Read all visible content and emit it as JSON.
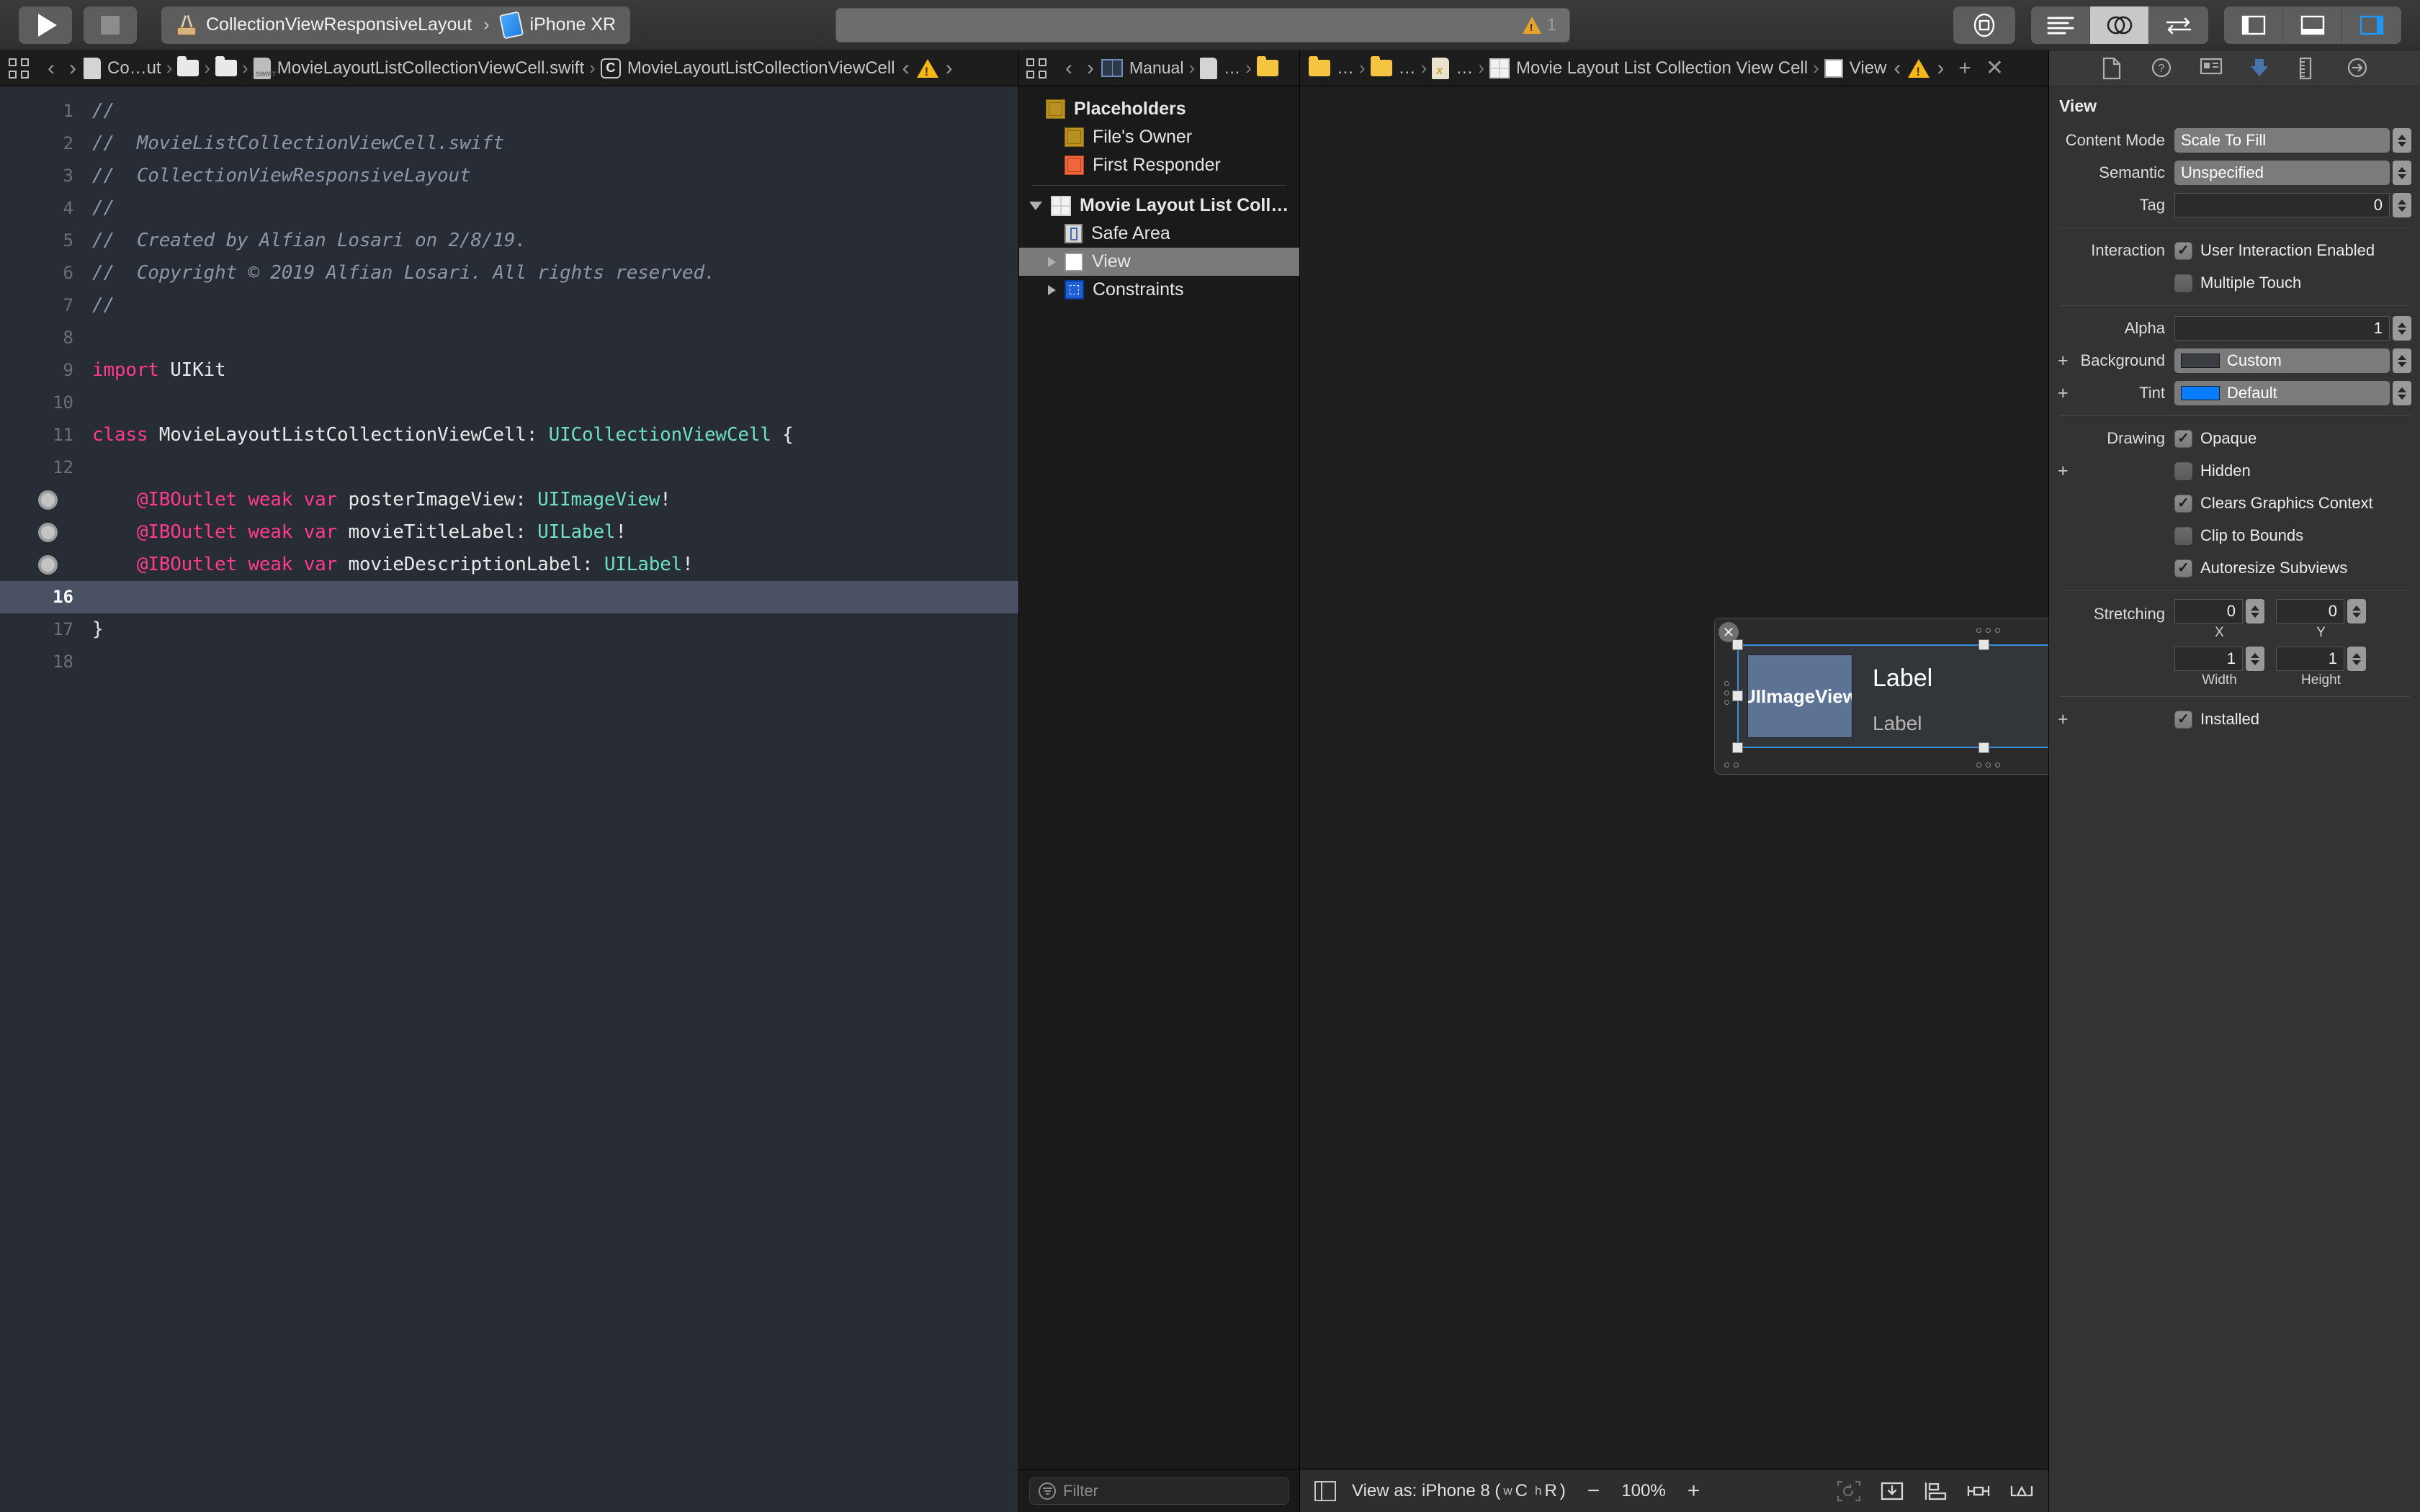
{
  "toolbar": {
    "run_label": "run-button",
    "stop_label": "stop-button",
    "scheme": "CollectionViewResponsiveLayout",
    "destination": "iPhone XR",
    "chevron": "›",
    "warning_count": "1",
    "icons": {
      "library": "library-icon",
      "standard_editor": "standard-editor-icon",
      "assistant_editor": "assistant-editor-icon",
      "version_editor": "version-editor-icon",
      "nav_panel": "navigator-toggle-icon",
      "debug_panel": "debug-area-toggle-icon",
      "utility_panel": "utilities-toggle-icon"
    }
  },
  "editor": {
    "jumpbar": [
      {
        "icon": "project-icon",
        "label": "Co…ut"
      },
      {
        "icon": "folder-icon",
        "label": ""
      },
      {
        "icon": "folder-icon",
        "label": ""
      },
      {
        "icon": "swift-file-icon",
        "label": "MovieLayoutListCollectionViewCell.swift"
      },
      {
        "icon": "class-icon",
        "label": "MovieLayoutListCollectionViewCell"
      }
    ],
    "lines": [
      {
        "n": "1",
        "bp": false,
        "cur": false,
        "tokens": [
          {
            "t": "cmt",
            "s": "//"
          }
        ]
      },
      {
        "n": "2",
        "bp": false,
        "cur": false,
        "tokens": [
          {
            "t": "cmt",
            "s": "//  MovieListCollectionViewCell.swift"
          }
        ]
      },
      {
        "n": "3",
        "bp": false,
        "cur": false,
        "tokens": [
          {
            "t": "cmt",
            "s": "//  CollectionViewResponsiveLayout"
          }
        ]
      },
      {
        "n": "4",
        "bp": false,
        "cur": false,
        "tokens": [
          {
            "t": "cmt",
            "s": "//"
          }
        ]
      },
      {
        "n": "5",
        "bp": false,
        "cur": false,
        "tokens": [
          {
            "t": "cmt",
            "s": "//  Created by Alfian Losari on 2/8/19."
          }
        ]
      },
      {
        "n": "6",
        "bp": false,
        "cur": false,
        "tokens": [
          {
            "t": "cmt",
            "s": "//  Copyright © 2019 Alfian Losari. All rights reserved."
          }
        ]
      },
      {
        "n": "7",
        "bp": false,
        "cur": false,
        "tokens": [
          {
            "t": "cmt",
            "s": "//"
          }
        ]
      },
      {
        "n": "8",
        "bp": false,
        "cur": false,
        "tokens": []
      },
      {
        "n": "9",
        "bp": false,
        "cur": false,
        "tokens": [
          {
            "t": "kw",
            "s": "import"
          },
          {
            "t": "plain",
            "s": " UIKit"
          }
        ]
      },
      {
        "n": "10",
        "bp": false,
        "cur": false,
        "tokens": []
      },
      {
        "n": "11",
        "bp": false,
        "cur": false,
        "tokens": [
          {
            "t": "kw",
            "s": "class"
          },
          {
            "t": "plain",
            "s": " MovieLayoutListCollectionViewCell: "
          },
          {
            "t": "type",
            "s": "UICollectionViewCell"
          },
          {
            "t": "plain",
            "s": " {"
          }
        ]
      },
      {
        "n": "12",
        "bp": false,
        "cur": false,
        "tokens": []
      },
      {
        "n": "13",
        "bp": true,
        "cur": false,
        "tokens": [
          {
            "t": "plain",
            "s": "    "
          },
          {
            "t": "kw",
            "s": "@IBOutlet weak var"
          },
          {
            "t": "plain",
            "s": " posterImageView: "
          },
          {
            "t": "type",
            "s": "UIImageView"
          },
          {
            "t": "plain",
            "s": "!"
          }
        ]
      },
      {
        "n": "14",
        "bp": true,
        "cur": false,
        "tokens": [
          {
            "t": "plain",
            "s": "    "
          },
          {
            "t": "kw",
            "s": "@IBOutlet weak var"
          },
          {
            "t": "plain",
            "s": " movieTitleLabel: "
          },
          {
            "t": "type",
            "s": "UILabel"
          },
          {
            "t": "plain",
            "s": "!"
          }
        ]
      },
      {
        "n": "15",
        "bp": true,
        "cur": false,
        "tokens": [
          {
            "t": "plain",
            "s": "    "
          },
          {
            "t": "kw",
            "s": "@IBOutlet weak var"
          },
          {
            "t": "plain",
            "s": " movieDescriptionLabel: "
          },
          {
            "t": "type",
            "s": "UILabel"
          },
          {
            "t": "plain",
            "s": "!"
          }
        ]
      },
      {
        "n": "16",
        "bp": false,
        "cur": true,
        "tokens": []
      },
      {
        "n": "17",
        "bp": false,
        "cur": false,
        "tokens": [
          {
            "t": "plain",
            "s": "}"
          }
        ]
      },
      {
        "n": "18",
        "bp": false,
        "cur": false,
        "tokens": []
      }
    ]
  },
  "outline": {
    "jumpbar": [
      {
        "icon": "manual-icon",
        "label": "Manual"
      },
      {
        "icon": "project-icon",
        "label": "…"
      },
      {
        "icon": "folder-icon",
        "label": "…"
      }
    ],
    "items": [
      {
        "label": "Placeholders",
        "icon": "cube-icon",
        "indent": 0,
        "bold": true,
        "selected": false,
        "triangle": "none"
      },
      {
        "label": "File's Owner",
        "icon": "cube-icon",
        "indent": 1,
        "bold": false,
        "selected": false,
        "triangle": "none"
      },
      {
        "label": "First Responder",
        "icon": "responder-icon",
        "indent": 1,
        "bold": false,
        "selected": false,
        "triangle": "none"
      },
      {
        "label": "Movie Layout List Coll…",
        "icon": "cell-icon",
        "indent": 0,
        "bold": true,
        "selected": false,
        "triangle": "open"
      },
      {
        "label": "Safe Area",
        "icon": "safe-area-icon",
        "indent": 1,
        "bold": false,
        "selected": false,
        "triangle": "none"
      },
      {
        "label": "View",
        "icon": "view-icon",
        "indent": 1,
        "bold": false,
        "selected": true,
        "triangle": "closed"
      },
      {
        "label": "Constraints",
        "icon": "constraints-icon",
        "indent": 1,
        "bold": false,
        "selected": false,
        "triangle": "closed"
      }
    ],
    "filter_placeholder": "Filter"
  },
  "canvas": {
    "jumpbar": [
      {
        "icon": "folder-yellow-icon",
        "label": "…"
      },
      {
        "icon": "folder-yellow-icon",
        "label": "…"
      },
      {
        "icon": "xib-file-icon",
        "label": "…"
      },
      {
        "icon": "cell-icon",
        "label": "Movie Layout List Collection View Cell"
      },
      {
        "icon": "view-icon",
        "label": "View"
      }
    ],
    "cell": {
      "poster_label": "UIImageView",
      "title_label": "Label",
      "description_label": "Label"
    },
    "footer": {
      "view_as_prefix": "View as: iPhone 8 (",
      "width_class_prefix": "w",
      "width_class": "C",
      "height_class_prefix": "h",
      "height_class": "R",
      "view_as_suffix": ")",
      "minus": "−",
      "zoom": "100%",
      "plus": "+",
      "icons": [
        "update-frames-icon",
        "embed-in-icon",
        "align-icon",
        "add-new-constraints-icon",
        "resolve-auto-layout-issues-icon"
      ]
    }
  },
  "inspector": {
    "tabs": [
      "file-inspector-icon",
      "quick-help-inspector-icon",
      "identity-inspector-icon",
      "attributes-inspector-icon",
      "size-inspector-icon",
      "connections-inspector-icon"
    ],
    "active_tab_index": 3,
    "section_title": "View",
    "content_mode": {
      "label": "Content Mode",
      "value": "Scale To Fill"
    },
    "semantic": {
      "label": "Semantic",
      "value": "Unspecified"
    },
    "tag": {
      "label": "Tag",
      "value": "0"
    },
    "interaction": {
      "label": "Interaction",
      "options": [
        {
          "label": "User Interaction Enabled",
          "checked": true
        },
        {
          "label": "Multiple Touch",
          "checked": false
        }
      ]
    },
    "alpha": {
      "label": "Alpha",
      "value": "1"
    },
    "background": {
      "label": "Background",
      "value": "Custom",
      "color": "#3a3d42"
    },
    "tint": {
      "label": "Tint",
      "value": "Default",
      "color": "#0a7cff"
    },
    "drawing": {
      "label": "Drawing",
      "options": [
        {
          "label": "Opaque",
          "checked": true
        },
        {
          "label": "Hidden",
          "checked": false
        },
        {
          "label": "Clears Graphics Context",
          "checked": true
        },
        {
          "label": "Clip to Bounds",
          "checked": false
        },
        {
          "label": "Autoresize Subviews",
          "checked": true
        }
      ]
    },
    "stretching": {
      "label": "Stretching",
      "x": {
        "value": "0",
        "sub": "X"
      },
      "y": {
        "value": "0",
        "sub": "Y"
      },
      "width": {
        "value": "1",
        "sub": "Width"
      },
      "height": {
        "value": "1",
        "sub": "Height"
      }
    },
    "installed": {
      "label": "Installed",
      "checked": true
    }
  }
}
